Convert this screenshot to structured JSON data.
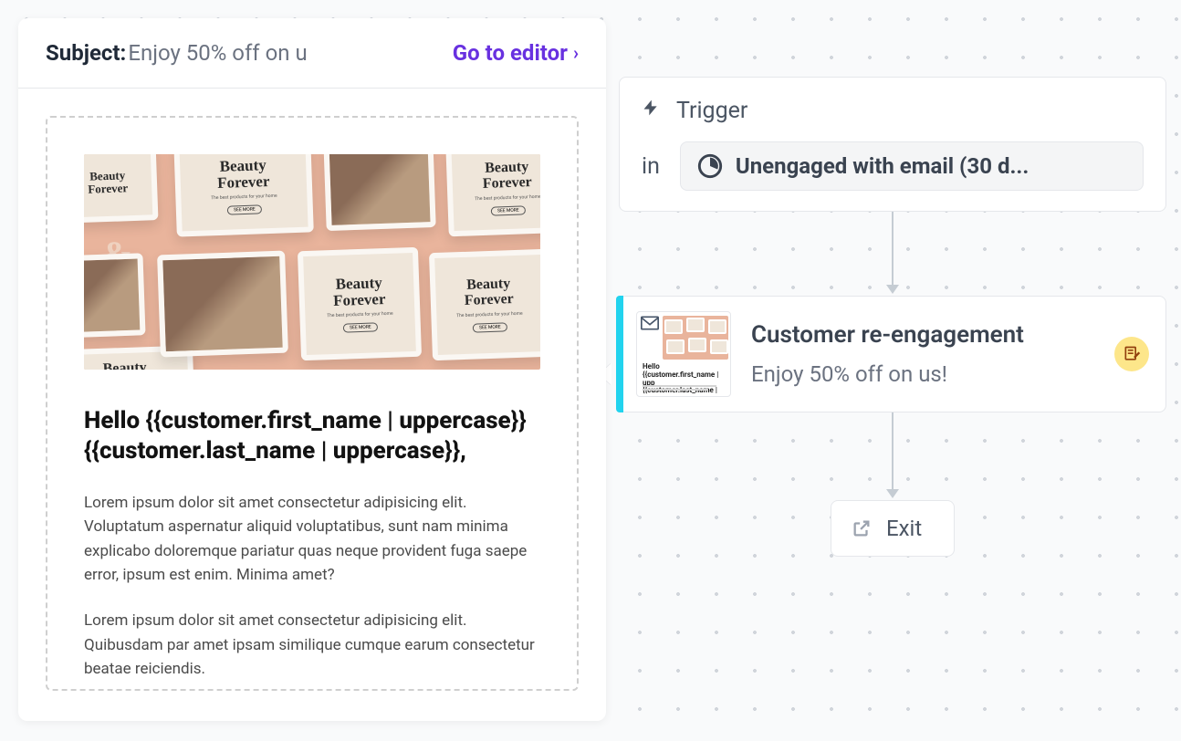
{
  "preview": {
    "subject_label": "Subject:",
    "subject_text": "Enjoy 50% off on u",
    "editor_link": "Go to editor",
    "brand_name": "Beauty Forever",
    "cta_small": "SEE MORE",
    "headline": "Hello {{customer.first_name | uppercase}} {{customer.last_name | uppercase}},",
    "body1": "Lorem ipsum dolor sit amet consectetur adipisicing elit. Voluptatum aspernatur aliquid voluptatibus, sunt nam minima explicabo doloremque pariatur quas neque provident fuga saepe error, ipsum est enim. Minima amet?",
    "body2": "Lorem ipsum dolor sit amet consectetur adipisicing elit. Quibusdam par amet ipsam similique cumque earum consectetur beatae reiciendis."
  },
  "flow": {
    "trigger": {
      "label": "Trigger",
      "in_label": "in",
      "segment": "Unengaged with email (30 d..."
    },
    "email_node": {
      "title": "Customer re-engagement",
      "subtitle": "Enjoy 50% off on us!",
      "thumb_text": "Hello {{customer.first_name | upp {{customer.last_name | uppercase"
    },
    "exit": {
      "label": "Exit"
    }
  }
}
